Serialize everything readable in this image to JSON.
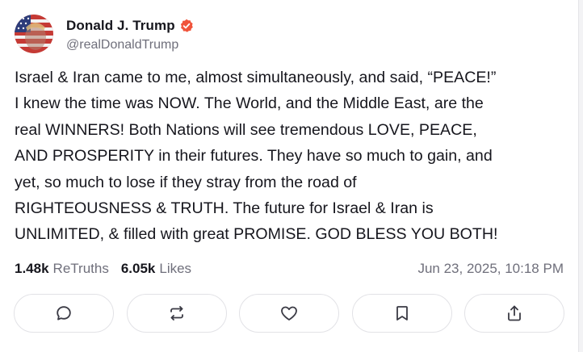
{
  "author": {
    "display_name": "Donald J. Trump",
    "handle": "@realDonaldTrump",
    "verified_color": "#f0533a"
  },
  "post": {
    "text": "Israel & Iran came to me, almost simultaneously, and said, “PEACE!”\nI knew the time was NOW. The World, and the Middle East, are the\nreal WINNERS! Both Nations will see tremendous LOVE, PEACE,\nAND PROSPERITY in their futures. They have so much to gain, and\nyet, so much to lose if they stray from the road of\nRIGHTEOUSNESS & TRUTH. The future for Israel & Iran is\nUNLIMITED, & filled with great PROMISE. GOD BLESS YOU BOTH!"
  },
  "stats": {
    "retruths_count": "1.48k",
    "retruths_label": "ReTruths",
    "likes_count": "6.05k",
    "likes_label": "Likes",
    "timestamp": "Jun 23, 2025, 10:18 PM"
  },
  "actions": [
    {
      "name": "reply",
      "icon": "reply-icon"
    },
    {
      "name": "retruth",
      "icon": "retruth-icon"
    },
    {
      "name": "like",
      "icon": "heart-icon"
    },
    {
      "name": "bookmark",
      "icon": "bookmark-icon"
    },
    {
      "name": "share",
      "icon": "share-icon"
    }
  ],
  "colors": {
    "text_primary": "#16161d",
    "text_secondary": "#6f6f7b",
    "icon_color": "#3a3a44",
    "button_border": "#e2e2e6"
  }
}
